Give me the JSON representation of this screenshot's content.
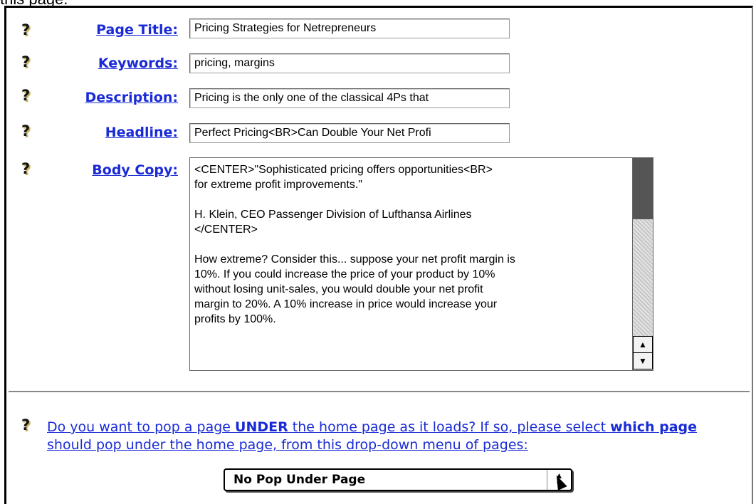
{
  "top_text": "this page.",
  "fields": {
    "page_title": {
      "label": "Page Title:",
      "value": "Pricing Strategies for Netrepreneurs"
    },
    "keywords": {
      "label": "Keywords:",
      "value": "pricing, margins"
    },
    "description": {
      "label": "Description:",
      "value": "Pricing is the only one of the classical 4Ps that"
    },
    "headline": {
      "label": "Headline:",
      "value": "Perfect Pricing<BR>Can Double Your Net Profi"
    },
    "body_copy": {
      "label": "Body Copy:",
      "value": "<CENTER>\"Sophisticated pricing offers opportunities<BR>\nfor extreme profit improvements.\"\n\nH. Klein, CEO Passenger Division of Lufthansa Airlines\n</CENTER>\n\nHow extreme? Consider this... suppose your net profit margin is\n10%. If you could increase the price of your product by 10%\nwithout losing unit-sales, you would double your net profit\nmargin to 20%. A 10% increase in price would increase your\nprofits by 100%."
    }
  },
  "help_glyph": "?",
  "popunder": {
    "question_part1": "Do you want to pop a page ",
    "question_bold1": "UNDER",
    "question_part2": " the home page as it loads? If so, please select ",
    "question_bold2": "which page",
    "question_part3": " should pop under the home page, from this drop-down menu of pages:",
    "selected": "No Pop Under Page"
  }
}
